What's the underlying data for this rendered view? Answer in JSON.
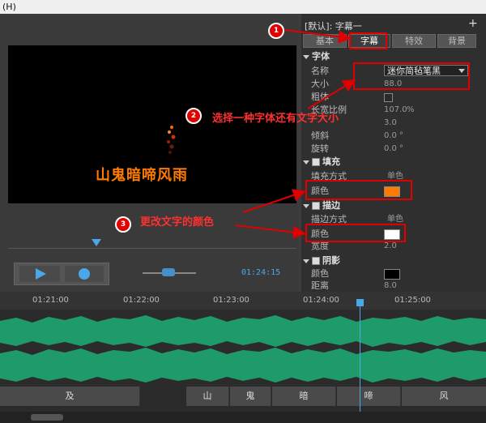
{
  "menu": {
    "help_label": "(H)"
  },
  "preview": {
    "caption": "山鬼暗啼风雨",
    "timecode": "01:24:15"
  },
  "panel": {
    "preset_label": "[默认]: 字幕一",
    "plus": "+",
    "tabs": [
      "基本",
      "字幕",
      "特效",
      "背景"
    ],
    "font_section": "字体",
    "name_label": "名称",
    "font_name": "迷你简毡笔黑",
    "size_label": "大小",
    "size_value": "88.0",
    "bold_label": "粗体",
    "ratio_label": "长宽比例",
    "ratio_value": "107.0",
    "ratio_unit": "%",
    "spacing_value": "3.0",
    "slant_label": "倾斜",
    "slant_value": "0.0",
    "slant_unit": "°",
    "rotate_label": "旋转",
    "rotate_value": "0.0",
    "rotate_unit": "°",
    "fill_section": "填充",
    "fill_mode_label": "填充方式",
    "fill_mode_value": "单色",
    "fill_color_label": "颜色",
    "stroke_section": "描边",
    "stroke_mode_label": "描边方式",
    "stroke_mode_value": "单色",
    "stroke_color_label": "颜色",
    "width_label": "宽度",
    "width_value": "2.0",
    "shadow_section": "阴影",
    "shadow_color_label": "颜色",
    "distance_label": "距离",
    "distance_value": "8.0"
  },
  "colors": {
    "fill": "#ff7a00",
    "stroke": "#ffffff",
    "shadow": "#000000",
    "accent": "#4aa8e8",
    "annotation": "#e00000"
  },
  "annotations": {
    "badge1": "1",
    "badge2": "2",
    "badge3": "3",
    "step2_text": "选择一种字体还有文字大小",
    "step3_text": "更改文字的颜色"
  },
  "timeline": {
    "ticks": [
      "01:21:00",
      "01:22:00",
      "01:23:00",
      "01:24:00",
      "01:25:00"
    ],
    "clips": [
      "及",
      "山",
      "鬼",
      "暗",
      "啼",
      "风"
    ]
  }
}
